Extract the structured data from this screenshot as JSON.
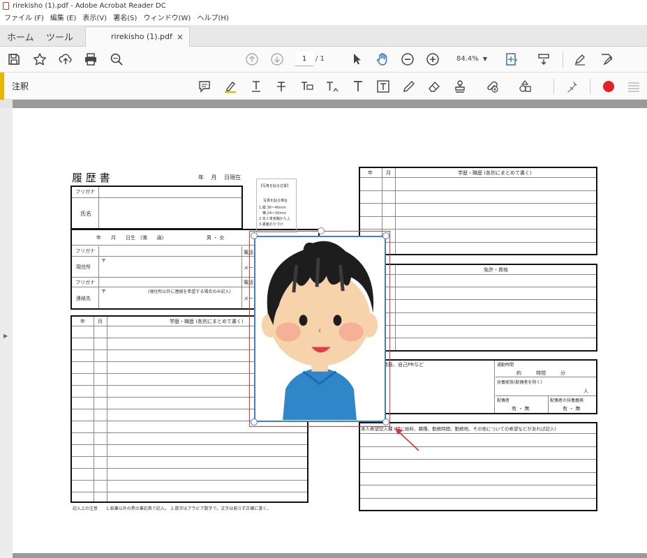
{
  "window": {
    "title": "rirekisho (1).pdf - Adobe Acrobat Reader DC"
  },
  "menu": [
    "ファイル (F)",
    "編集 (E)",
    "表示(V)",
    "署名(S)",
    "ウィンドウ(W)",
    "ヘルプ(H)"
  ],
  "tabs": {
    "home": "ホーム",
    "tools": "ツール",
    "document": "rirekisho (1).pdf",
    "close": "×"
  },
  "toolbar": {
    "page_current": "1",
    "page_total": "/  1",
    "zoom": "84.4%"
  },
  "annot": {
    "label": "注釈",
    "record_color": "#e22222"
  },
  "resume": {
    "title": "履 歴 書",
    "date_line": "年　 月 　日現在",
    "furigana": "フリガナ",
    "name": "氏名",
    "birth": "年　　月　　日生　(満　　歳)",
    "gender": "男 ・ 女",
    "furigana2": "フリガナ",
    "address": "現住所",
    "postal": "〒",
    "furigana3": "フリガナ",
    "contact": "連絡先",
    "postal2": "〒",
    "contact_note": "(現住所以外に連絡を希望する場合のみ記入)",
    "phone_short": "電話",
    "mail_short": "メー",
    "phone_short2": "電話",
    "mail_short2": "メー",
    "photo_title": "【写真を貼る位置】",
    "photo_instr": [
      "写真を貼る場合",
      "1.縦:36～40mm",
      "　横:24～30mm",
      "2.本人単身胸から上",
      "3.裏面のりづけ"
    ],
    "hist_year": "年",
    "hist_month": "月",
    "hist_header": "学歴・職歴 (各別にまとめて書く)",
    "hist_year2": "年",
    "hist_month2": "月",
    "hist_header2": "学歴・職歴 (各別にまとめて書く)",
    "license_header": "免許・資格",
    "skills": "特技、自己PRなど",
    "commute": "通勤時間",
    "commute_val": "約　　　時間　　　分",
    "dependents": "扶養家族(配偶者を除く)",
    "dependents_unit": "人",
    "spouse": "配偶者",
    "spouse_val": "有 ・ 無",
    "spouse_support": "配偶者の扶養義務",
    "spouse_support_val": "有 ・ 無",
    "wishes": "本人希望記入欄 (特に給料、職種、勤務時間、勤務地、その他についての希望などがあれば記入)",
    "footnote": "記入上の注意　　1.鉛筆以外の黒の筆記具で記入。　2.数字はアラビア数字で。文字は崩さず正確に書く。"
  }
}
